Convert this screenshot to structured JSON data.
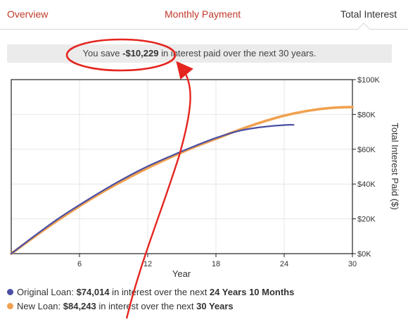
{
  "tabs": {
    "overview": "Overview",
    "monthly_payment": "Monthly Payment",
    "total_interest": "Total Interest"
  },
  "savings_banner": {
    "prefix": "You save ",
    "amount": "-$10,229",
    "suffix": " in interest paid over the next 30 years."
  },
  "legend": [
    {
      "color": "#4a4fa3",
      "label": "Original Loan: ",
      "amount": "$74,014",
      "middle": " in interest over the next ",
      "term": "24 Years 10 Months"
    },
    {
      "color": "#f0a14f",
      "label": "New Loan: ",
      "amount": "$84,243",
      "middle": " in interest over the next ",
      "term": "30 Years"
    }
  ],
  "annotation": {
    "color": "#e5251f"
  },
  "chart_data": {
    "type": "line",
    "xlabel": "Year",
    "ylabel": "Total Interest Paid ($)",
    "x_ticks": [
      "6",
      "12",
      "18",
      "24",
      "30"
    ],
    "y_ticks": [
      "$0K",
      "$20K",
      "$40K",
      "$60K",
      "$80K",
      "$100K"
    ],
    "xlim": [
      0,
      30
    ],
    "ylim": [
      0,
      100000
    ],
    "grid": true,
    "series": [
      {
        "name": "Original Loan",
        "color": "#4a4fa3",
        "x": [
          0,
          2,
          4,
          6,
          8,
          10,
          12,
          14,
          16,
          18,
          20,
          22,
          24,
          24.83
        ],
        "y": [
          0,
          10000,
          19500,
          28000,
          36000,
          43500,
          50200,
          56000,
          61500,
          66500,
          70500,
          72700,
          73900,
          74014
        ]
      },
      {
        "name": "New Loan",
        "color": "#f0a14f",
        "x": [
          0,
          2,
          4,
          6,
          8,
          10,
          12,
          14,
          16,
          18,
          20,
          22,
          24,
          26,
          28,
          30
        ],
        "y": [
          0,
          9500,
          18700,
          27300,
          35300,
          42500,
          49200,
          55300,
          61000,
          66000,
          71000,
          75500,
          79300,
          82000,
          83700,
          84243
        ]
      }
    ]
  }
}
